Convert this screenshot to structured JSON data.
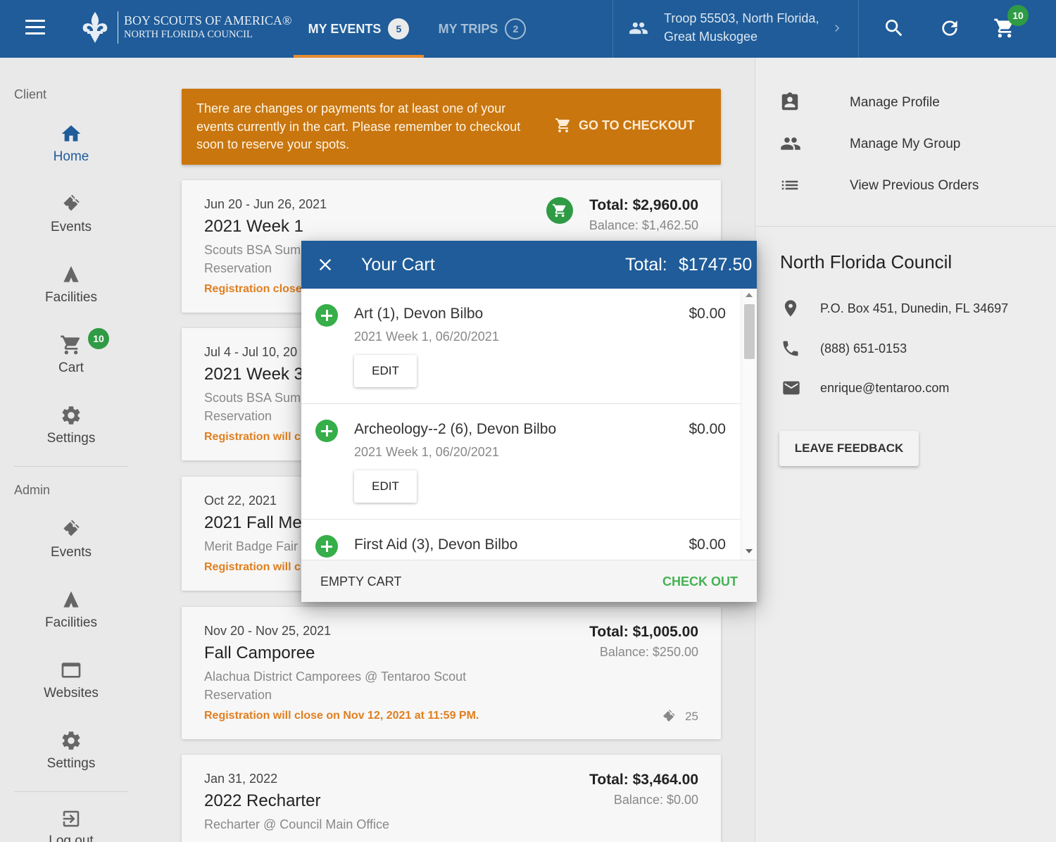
{
  "colors": {
    "brand_blue": "#1f5c99",
    "accent_orange": "#e68a2e",
    "alert_bg": "#c9760f",
    "success_green": "#2f9b45",
    "checkout_green": "#45b253"
  },
  "header": {
    "logo_line1": "BOY SCOUTS OF AMERICA®",
    "logo_line2": "NORTH FLORIDA COUNCIL",
    "tabs": [
      {
        "label": "MY EVENTS",
        "count": "5",
        "active": true
      },
      {
        "label": "MY TRIPS",
        "count": "2",
        "active": false
      }
    ],
    "troop": "Troop 55503, North Florida, Great Muskogee",
    "cart_count": "10",
    "icons": [
      "menu-icon",
      "group-icon",
      "chevron-right-icon",
      "search-icon",
      "refresh-icon",
      "cart-icon"
    ]
  },
  "sidebar": {
    "client_label": "Client",
    "admin_label": "Admin",
    "client_items": [
      {
        "label": "Home",
        "icon": "home-icon"
      },
      {
        "label": "Events",
        "icon": "tickets-icon"
      },
      {
        "label": "Facilities",
        "icon": "tent-icon"
      },
      {
        "label": "Cart",
        "icon": "cart-icon",
        "badge": "10"
      },
      {
        "label": "Settings",
        "icon": "gear-icon"
      }
    ],
    "admin_items": [
      {
        "label": "Events",
        "icon": "tickets-icon"
      },
      {
        "label": "Facilities",
        "icon": "tent-icon"
      },
      {
        "label": "Websites",
        "icon": "browser-icon"
      },
      {
        "label": "Settings",
        "icon": "gear-icon"
      },
      {
        "label": "Log out",
        "icon": "logout-icon"
      }
    ]
  },
  "alert": {
    "text": "There are changes or payments for at least one of your events currently in the cart. Please remember to checkout soon to reserve your spots.",
    "button": "GO TO CHECKOUT"
  },
  "events": [
    {
      "date": "Jun 20 - Jun 26, 2021",
      "title": "2021 Week 1",
      "location": "Scouts BSA Sum",
      "location2": "Reservation",
      "registration": "Registration close",
      "total": "Total: $2,960.00",
      "balance": "Balance: $1,462.50"
    },
    {
      "date": "Jul 4 - Jul 10, 20",
      "title": "2021 Week 3",
      "location": "Scouts BSA Sum",
      "location2": "Reservation",
      "registration": "Registration will c"
    },
    {
      "date": "Oct 22, 2021",
      "title": "2021 Fall Me",
      "location": "Merit Badge Fair",
      "registration": "Registration will c"
    },
    {
      "date": "Nov 20 - Nov 25, 2021",
      "title": "Fall Camporee",
      "location": "Alachua District Camporees @ Tentaroo Scout Reservation",
      "registration": "Registration will close on Nov 12, 2021 at 11:59 PM.",
      "total": "Total: $1,005.00",
      "balance": "Balance: $250.00",
      "count": "25"
    },
    {
      "date": "Jan 31, 2022",
      "title": "2022 Recharter",
      "location": "Recharter @ Council Main Office",
      "total": "Total: $3,464.00",
      "balance": "Balance: $0.00"
    }
  ],
  "right_panel": {
    "links": [
      {
        "label": "Manage Profile",
        "icon": "profile-icon"
      },
      {
        "label": "Manage My Group",
        "icon": "group-icon"
      },
      {
        "label": "View Previous Orders",
        "icon": "list-icon"
      }
    ],
    "council": "North Florida Council",
    "address": "P.O. Box 451, Dunedin, FL 34697",
    "phone": "(888) 651-0153",
    "email": "enrique@tentaroo.com",
    "feedback": "LEAVE FEEDBACK"
  },
  "cart_dialog": {
    "title": "Your Cart",
    "total_label": "Total:",
    "total_value": "$1747.50",
    "items": [
      {
        "name": "Art (1), Devon Bilbo",
        "sub": "2021 Week 1, 06/20/2021",
        "price": "$0.00",
        "edit": "EDIT"
      },
      {
        "name": "Archeology--2 (6), Devon Bilbo",
        "sub": "2021 Week 1, 06/20/2021",
        "price": "$0.00",
        "edit": "EDIT"
      },
      {
        "name": "First Aid (3), Devon Bilbo",
        "sub": "",
        "price": "$0.00",
        "edit": ""
      }
    ],
    "empty_label": "EMPTY CART",
    "checkout_label": "CHECK OUT"
  }
}
